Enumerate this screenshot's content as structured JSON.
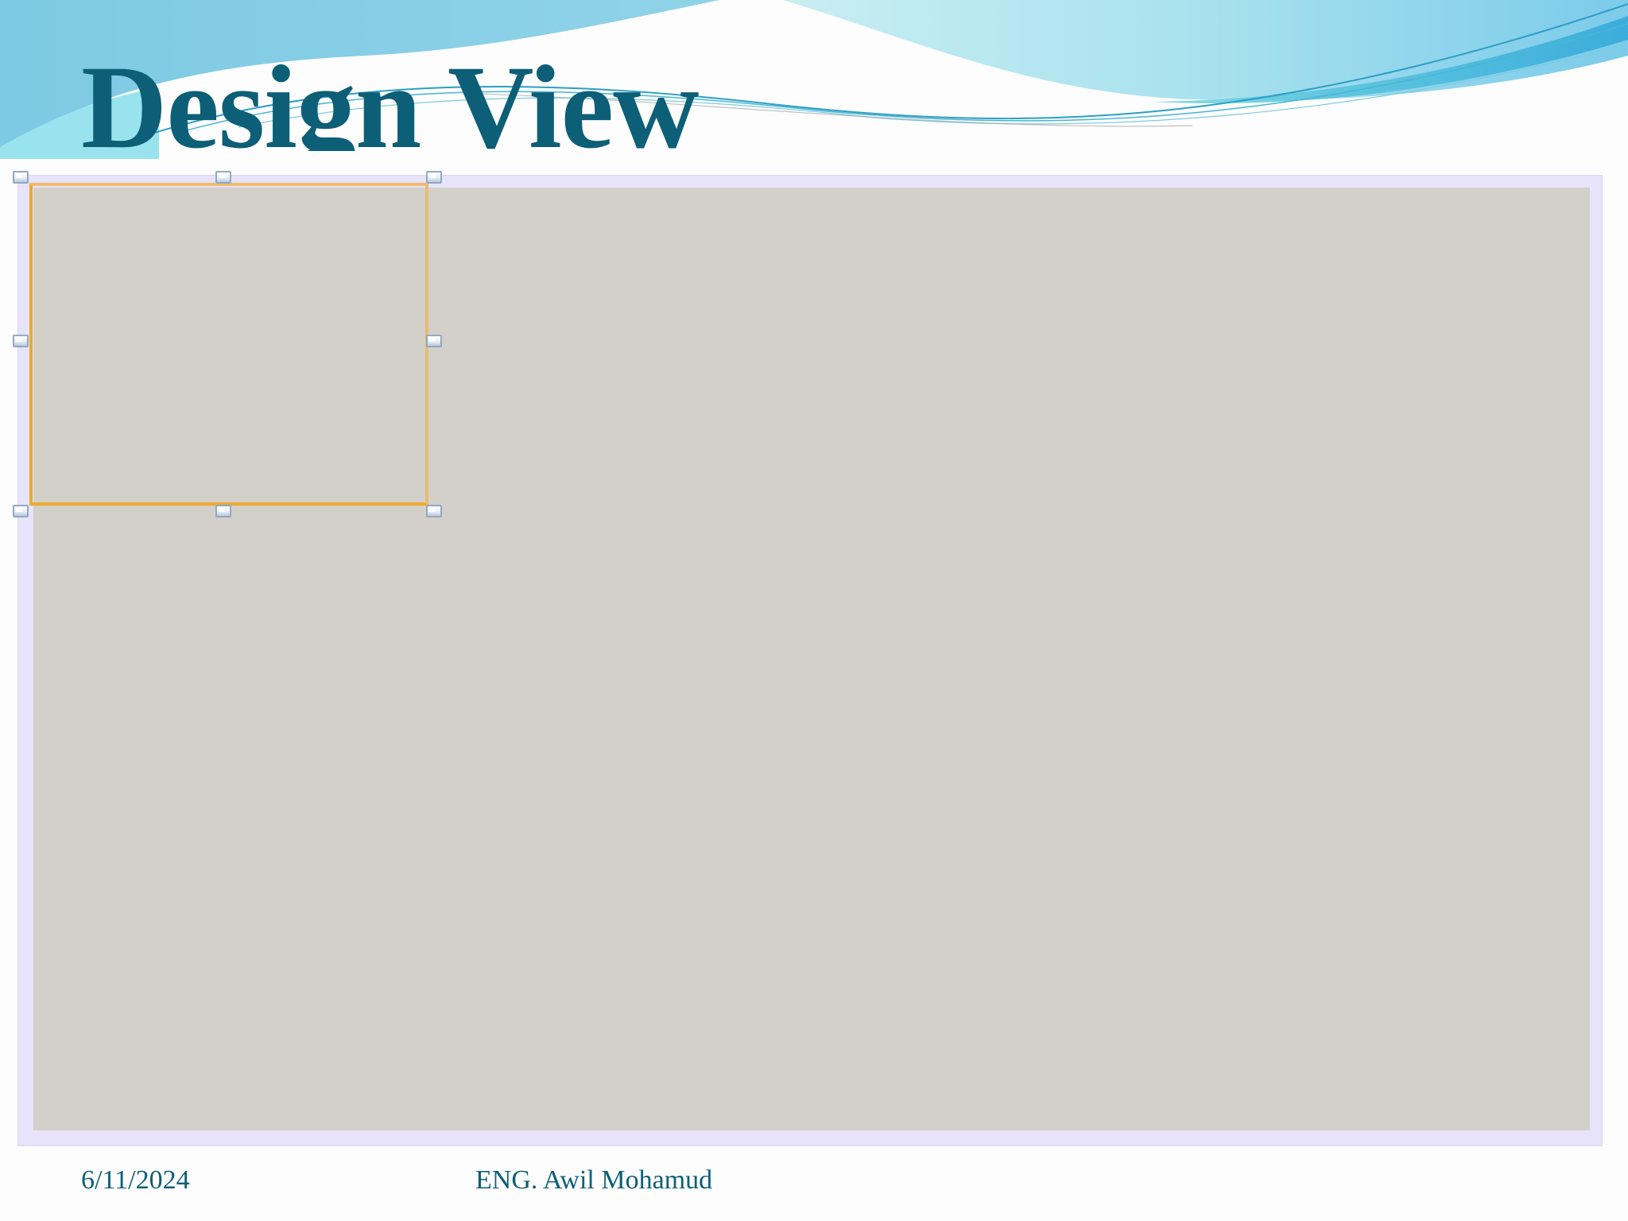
{
  "slide": {
    "title": "Design View",
    "footer_date": "6/11/2024",
    "footer_author": "ENG. Awil Mohamud"
  },
  "colors": {
    "title": "#0d5f77",
    "canvas": "#d3d0ca",
    "frame": "#e6e3fa",
    "selection_border": "#eeaa2c",
    "handle_border": "#93a9c3"
  },
  "icons": {
    "resize_handle": "resize-handle-icon"
  }
}
